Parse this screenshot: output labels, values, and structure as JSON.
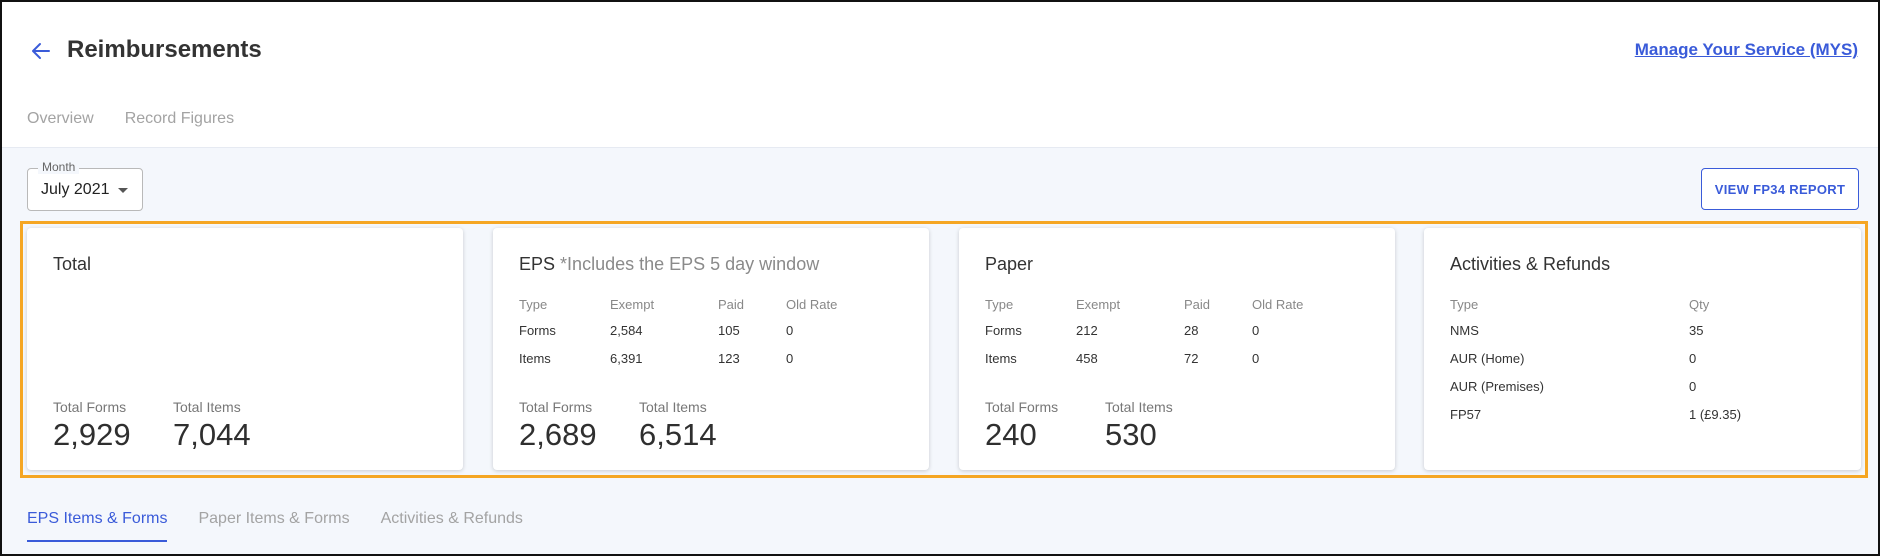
{
  "header": {
    "title": "Reimbursements",
    "mys_link": "Manage Your Service (MYS)",
    "tabs": [
      "Overview",
      "Record Figures"
    ]
  },
  "filters": {
    "month_label": "Month",
    "month_value": "July 2021"
  },
  "actions": {
    "fp34_button": "VIEW FP34 REPORT"
  },
  "cards": {
    "total": {
      "title": "Total",
      "forms_label": "Total Forms",
      "forms_value": "2,929",
      "items_label": "Total Items",
      "items_value": "7,044"
    },
    "eps": {
      "title": "EPS",
      "subtitle": "*Includes the EPS 5 day window",
      "columns": [
        "Type",
        "Exempt",
        "Paid",
        "Old Rate"
      ],
      "rows": [
        [
          "Forms",
          "2,584",
          "105",
          "0"
        ],
        [
          "Items",
          "6,391",
          "123",
          "0"
        ]
      ],
      "forms_label": "Total Forms",
      "forms_value": "2,689",
      "items_label": "Total Items",
      "items_value": "6,514"
    },
    "paper": {
      "title": "Paper",
      "columns": [
        "Type",
        "Exempt",
        "Paid",
        "Old Rate"
      ],
      "rows": [
        [
          "Forms",
          "212",
          "28",
          "0"
        ],
        [
          "Items",
          "458",
          "72",
          "0"
        ]
      ],
      "forms_label": "Total Forms",
      "forms_value": "240",
      "items_label": "Total Items",
      "items_value": "530"
    },
    "activities": {
      "title": "Activities & Refunds",
      "columns": [
        "Type",
        "Qty"
      ],
      "rows": [
        [
          "NMS",
          "35"
        ],
        [
          "AUR (Home)",
          "0"
        ],
        [
          "AUR (Premises)",
          "0"
        ],
        [
          "FP57",
          "1 (£9.35)"
        ]
      ]
    }
  },
  "bottom_tabs": [
    "EPS Items & Forms",
    "Paper Items & Forms",
    "Activities & Refunds"
  ],
  "colors": {
    "accent": "#3a5bd9",
    "highlight": "#f5a623",
    "background": "#f4f7fc"
  }
}
